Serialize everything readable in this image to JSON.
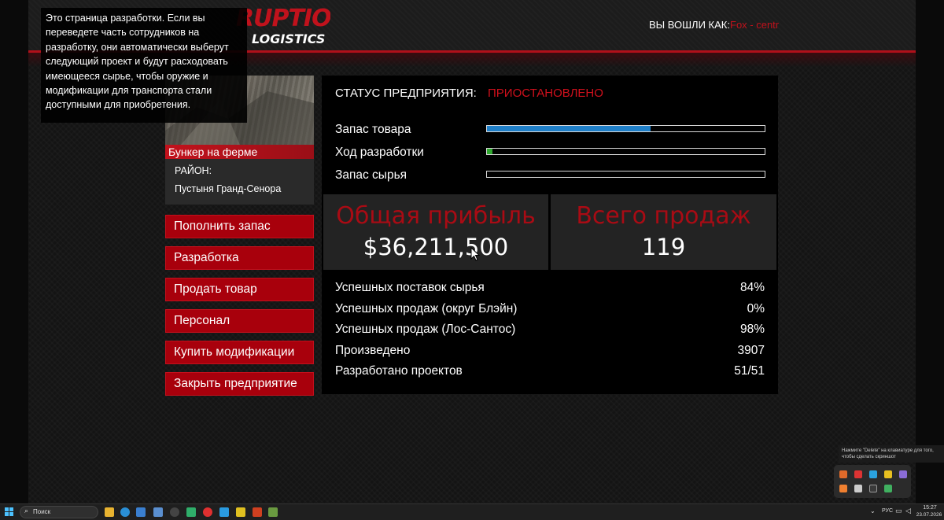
{
  "header": {
    "brand_top": "RUPTION",
    "brand_sub": "LOGISTICS",
    "logged_in_label": "ВЫ ВОШЛИ КАК:",
    "logged_in_user": "Fox - centr"
  },
  "help_tooltip": {
    "text": "Это страница разработки. Если вы переведете часть сотрудников на разработку, они автоматически выберут следующий проект и будут расходовать имеющееся сырье, чтобы оружие и модификации для транспорта стали доступными для приобретения."
  },
  "property": {
    "name": "Бункер на ферме",
    "district_label": "РАЙОН:",
    "district_value": "Пустыня Гранд-Сенора"
  },
  "actions": [
    {
      "label": "Пополнить запас"
    },
    {
      "label": "Разработка"
    },
    {
      "label": "Продать товар"
    },
    {
      "label": "Персонал"
    },
    {
      "label": "Купить модификации"
    },
    {
      "label": "Закрыть предприятие"
    }
  ],
  "status": {
    "label": "СТАТУС ПРЕДПРИЯТИЯ:",
    "value": "ПРИОСТАНОВЛЕНО"
  },
  "bars": [
    {
      "label": "Запас товара",
      "fraction": 0.59,
      "color": "#1f7fc8"
    },
    {
      "label": "Ход разработки",
      "fraction": 0.02,
      "color": "#2fa82f"
    },
    {
      "label": "Запас сырья",
      "fraction": 0.0,
      "color": "#1f7fc8"
    }
  ],
  "totals": {
    "profit_title": "Общая прибыль",
    "profit_value": "$36,211,500",
    "sales_title": "Всего продаж",
    "sales_value": "119"
  },
  "stats": [
    {
      "label": "Успешных поставок сырья",
      "value": "84%"
    },
    {
      "label": "Успешных продаж (округ Блэйн)",
      "value": "0%"
    },
    {
      "label": "Успешных продаж (Лос-Сантос)",
      "value": "98%"
    },
    {
      "label": "Произведено",
      "value": "3907"
    },
    {
      "label": "Разработано проектов",
      "value": "51/51"
    }
  ],
  "tray": {
    "hint": "Нажмите \"Delete\" на клавиатуре для того, чтобы сделать скриншот"
  },
  "taskbar": {
    "search_placeholder": "Поиск",
    "language": "РУС",
    "time": "15:27",
    "date": "23.07.2026"
  },
  "colors": {
    "accent_red": "#c0121c",
    "button_red": "#a8000c",
    "panel_black": "#000000",
    "stat_box": "#232323"
  }
}
